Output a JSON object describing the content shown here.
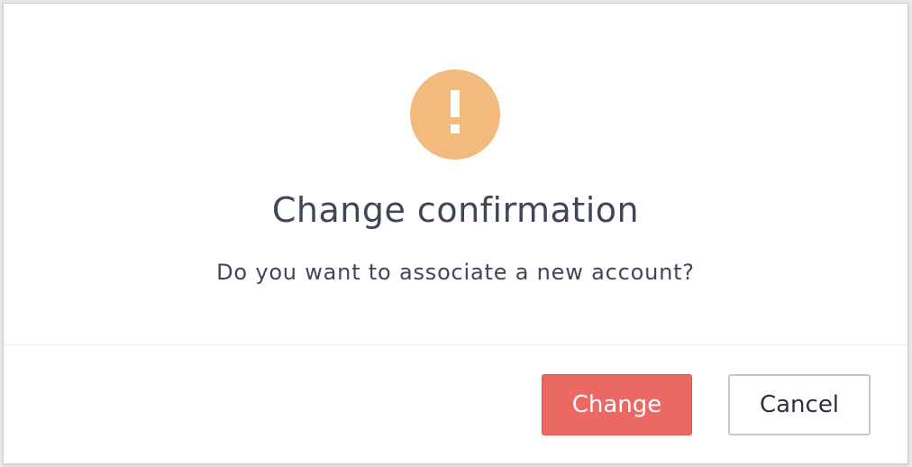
{
  "dialog": {
    "icon": "warning-exclamation-icon",
    "icon_color": "#f2bb7d",
    "title": "Change confirmation",
    "message": "Do you want to associate a new account?",
    "buttons": {
      "confirm_label": "Change",
      "confirm_color": "#ec6864",
      "cancel_label": "Cancel"
    }
  }
}
